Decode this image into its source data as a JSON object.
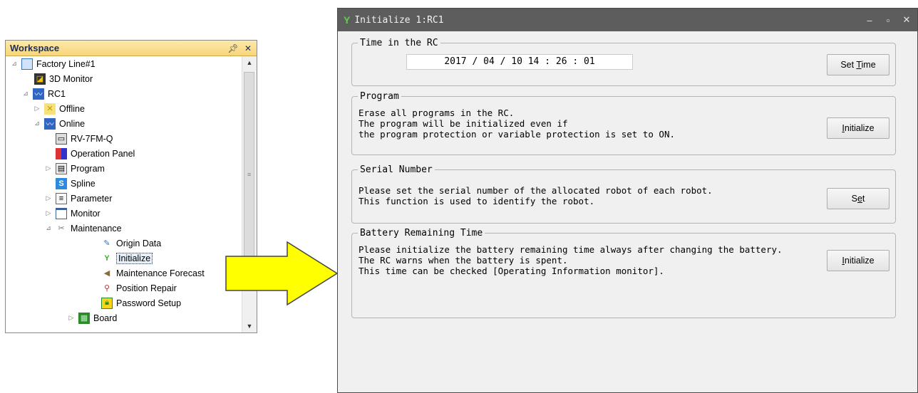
{
  "workspace": {
    "title": "Workspace",
    "pin_icon": "pin-icon",
    "close_icon": "close-icon",
    "tree": [
      {
        "label": "Factory Line#1",
        "expander": "⊿"
      },
      {
        "label": "3D Monitor"
      },
      {
        "label": "RC1",
        "expander": "⊿"
      },
      {
        "label": "Offline",
        "expander": "▷"
      },
      {
        "label": "Online",
        "expander": "⊿"
      },
      {
        "label": "RV-7FM-Q"
      },
      {
        "label": "Operation Panel"
      },
      {
        "label": "Program",
        "expander": "▷"
      },
      {
        "label": "Spline"
      },
      {
        "label": "Parameter",
        "expander": "▷"
      },
      {
        "label": "Monitor",
        "expander": "▷"
      },
      {
        "label": "Maintenance",
        "expander": "⊿"
      },
      {
        "label": "Origin Data"
      },
      {
        "label": "Initialize",
        "selected": true
      },
      {
        "label": "Maintenance Forecast"
      },
      {
        "label": "Position Repair"
      },
      {
        "label": "Password Setup"
      },
      {
        "label": "Board",
        "expander": "▷"
      }
    ]
  },
  "dialog": {
    "title": "Initialize 1:RC1",
    "time_group": {
      "legend": "Time in the RC",
      "value": "2017 / 04 / 10   14 : 26 : 01",
      "button_pre": "Set ",
      "button_key": "T",
      "button_post": "ime"
    },
    "program_group": {
      "legend": "Program",
      "lines": [
        "Erase all programs in the RC.",
        "The program will be initialized even if",
        "the program protection or variable protection is set to ON."
      ],
      "button_key": "I",
      "button_post": "nitialize"
    },
    "serial_group": {
      "legend": "Serial Number",
      "lines": [
        "Please set the serial number of the allocated robot of each robot.",
        "This function is used to identify the robot."
      ],
      "button_pre": "S",
      "button_key": "e",
      "button_post": "t"
    },
    "battery_group": {
      "legend": "Battery Remaining Time",
      "lines": [
        "Please initialize the battery remaining time always after changing the battery.",
        "The RC warns when the battery is spent.",
        "This time can be checked [Operating Information monitor]."
      ],
      "button_key": "I",
      "button_post": "nitialize"
    }
  },
  "colors": {
    "workspace_header": "#f8d57a",
    "dialog_titlebar": "#5d5d5d",
    "arrow_fill": "#ffff00"
  }
}
